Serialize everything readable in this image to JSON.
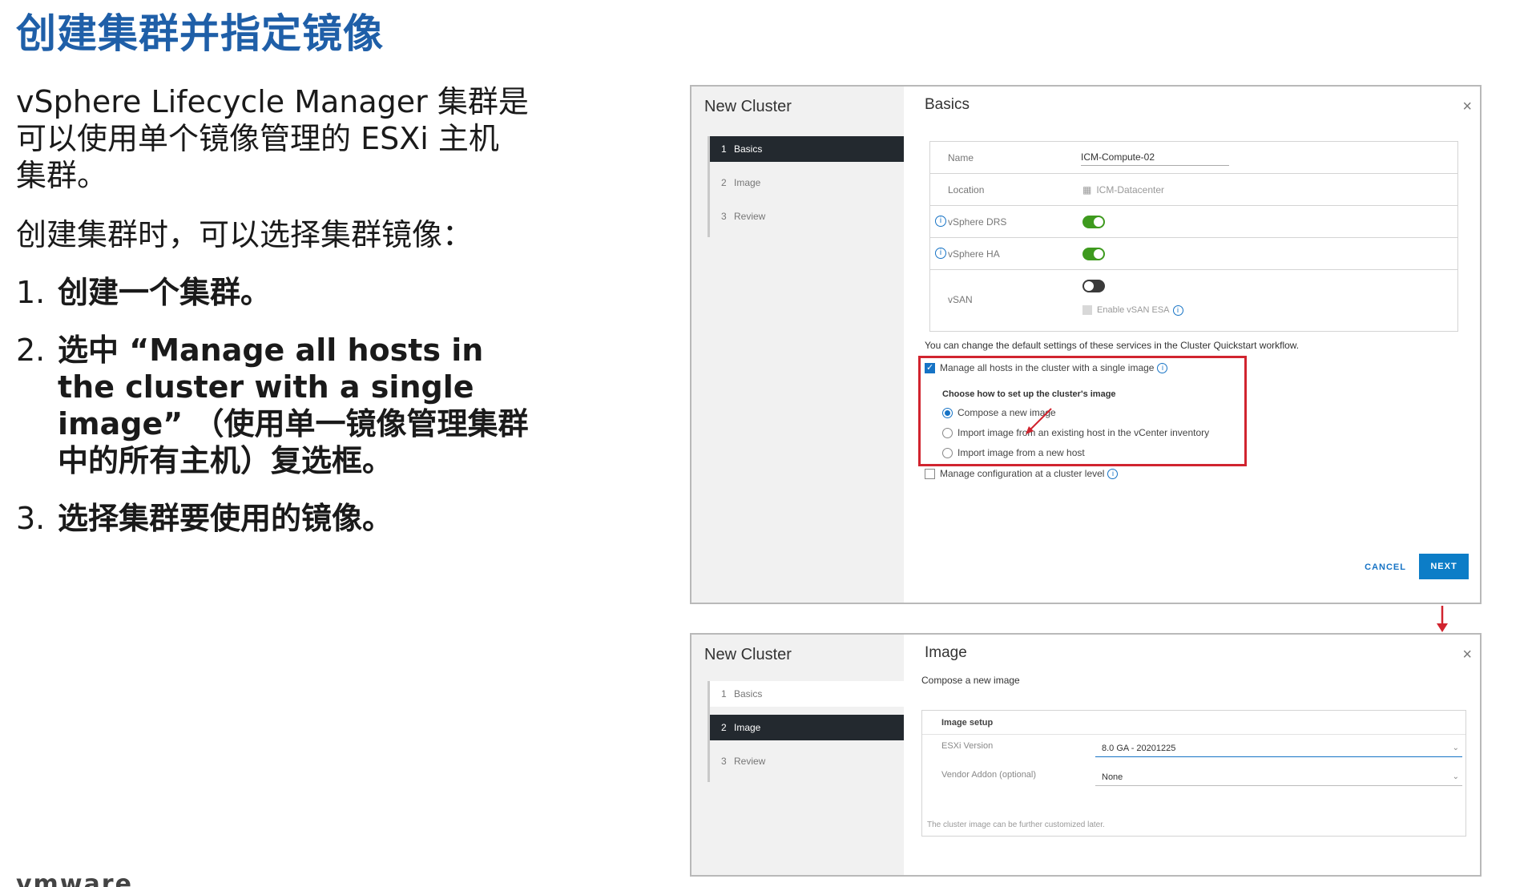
{
  "slide": {
    "title": "创建集群并指定镜像",
    "intro": "vSphere Lifecycle Manager 集群是可以使用单个镜像管理的 ESXi 主机集群。",
    "lead": "创建集群时，可以选择集群镜像：",
    "steps": [
      {
        "num": "1.",
        "text": "创建一个集群。"
      },
      {
        "num": "2.",
        "text": "选中 “Manage all hosts in the cluster with a single image” （使用单一镜像管理集群中的所有主机）复选框。"
      },
      {
        "num": "3.",
        "text": "选择集群要使用的镜像。"
      }
    ],
    "footer": "vmware"
  },
  "dialog1": {
    "title": "New Cluster",
    "steps": [
      {
        "num": "1",
        "label": "Basics"
      },
      {
        "num": "2",
        "label": "Image"
      },
      {
        "num": "3",
        "label": "Review"
      }
    ],
    "section": "Basics",
    "close": "×",
    "fields": {
      "name_label": "Name",
      "name_value": "ICM-Compute-02",
      "location_label": "Location",
      "location_value": "ICM-Datacenter",
      "drs_label": "vSphere DRS",
      "ha_label": "vSphere HA",
      "vsan_label": "vSAN",
      "esa_label": "Enable vSAN ESA"
    },
    "note": "You can change the default settings of these services in the Cluster Quickstart workflow.",
    "manage_single_image": "Manage all hosts in the cluster with a single image",
    "choose_heading": "Choose how to set up the cluster's image",
    "options": [
      "Compose a new image",
      "Import image from an existing host in the vCenter inventory",
      "Import image from a new host"
    ],
    "manage_config": "Manage configuration at a cluster level",
    "cancel": "CANCEL",
    "next": "NEXT"
  },
  "dialog2": {
    "title": "New Cluster",
    "steps": [
      {
        "num": "1",
        "label": "Basics"
      },
      {
        "num": "2",
        "label": "Image"
      },
      {
        "num": "3",
        "label": "Review"
      }
    ],
    "section": "Image",
    "subtitle": "Compose a new image",
    "close": "×",
    "setup_heading": "Image setup",
    "esxi_label": "ESXi Version",
    "esxi_value": "8.0 GA - 20201225",
    "vendor_label": "Vendor Addon (optional)",
    "vendor_value": "None",
    "footnote": "The cluster image can be further customized later."
  },
  "colors": {
    "title_blue": "#1f5fa8",
    "accent_blue": "#1673c5",
    "highlight_red": "#d1242f",
    "toggle_green": "#3e9a1e",
    "active_step": "#23292f"
  }
}
